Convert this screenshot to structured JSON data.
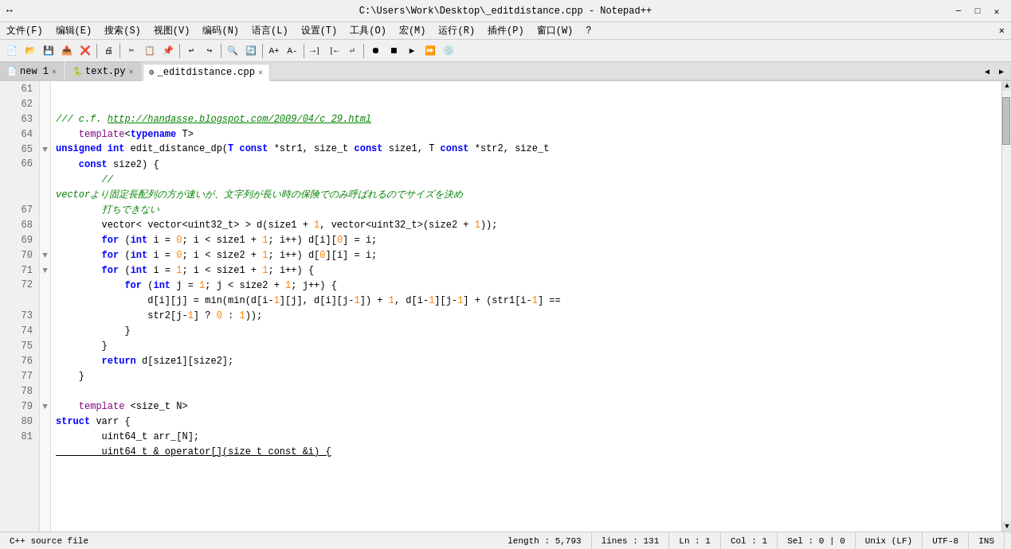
{
  "titlebar": {
    "title": "C:\\Users\\Work\\Desktop\\_editdistance.cpp - Notepad++",
    "minimize": "─",
    "maximize": "□",
    "close": "✕",
    "arrows": "↔"
  },
  "menubar": {
    "items": [
      "文件(F)",
      "编辑(E)",
      "搜索(S)",
      "视图(V)",
      "编码(N)",
      "语言(L)",
      "设置(T)",
      "工具(O)",
      "宏(M)",
      "运行(R)",
      "插件(P)",
      "窗口(W)",
      "?"
    ]
  },
  "tabs": [
    {
      "id": "new1",
      "label": "new 1",
      "icon": "📄",
      "active": false
    },
    {
      "id": "text_py",
      "label": "text.py",
      "icon": "🐍",
      "active": false
    },
    {
      "id": "editdistance",
      "label": "_editdistance.cpp",
      "icon": "⚙",
      "active": true
    }
  ],
  "statusbar": {
    "file_type": "C++ source file",
    "length": "length : 5,793",
    "lines": "lines : 131",
    "ln": "Ln : 1",
    "col": "Col : 1",
    "sel": "Sel : 0 | 0",
    "eol": "Unix (LF)",
    "encoding": "UTF-8",
    "ins": "INS"
  },
  "code": {
    "lines": [
      {
        "num": "61",
        "fold": "",
        "content": ""
      },
      {
        "num": "62",
        "fold": "",
        "content": ""
      },
      {
        "num": "63",
        "fold": "",
        "content": "    <comment>/// c.f. <url>http://handasse.blogspot.com/2009/04/c_29.html</url></comment>"
      },
      {
        "num": "64",
        "fold": "",
        "content": "    <template>template</template><plain>&lt;</plain><keyword>typename</keyword><plain> T&gt;</plain>"
      },
      {
        "num": "65",
        "fold": "▼",
        "content": "<keyword>unsigned</keyword><plain> </plain><keyword>int</keyword><plain> edit_distance_dp(</plain><keyword>T</keyword><plain> </plain><keyword>const</keyword><plain> *str1, size_t </plain><keyword>const</keyword><plain> size1, T </plain><keyword>const</keyword><plain> *str2, size_t</plain>"
      },
      {
        "num": "66",
        "fold": "",
        "content": "    <keyword>const</keyword><plain> size2) {</plain>\n        <comment>//</comment>\n        <comment>vectorより固定長配列の方が速いが、文字列が長い時の保険でのみ呼ばれるのでサイズを決め</comment>\n        <comment>打ちできない</comment>"
      },
      {
        "num": "67",
        "fold": "",
        "content": "        vector&lt; vector&lt;uint32_t&gt; &gt; d(size1 + <number>1</number>, vector&lt;uint32_t&gt;(size2 + <number>1</number>));"
      },
      {
        "num": "68",
        "fold": "",
        "content": "        <keyword>for</keyword> (<keyword>int</keyword> i = <number>0</number>; i &lt; size1 + <number>1</number>; i++) d[i][<number>0</number>] = i;"
      },
      {
        "num": "69",
        "fold": "",
        "content": "        <keyword>for</keyword> (<keyword>int</keyword> i = <number>0</number>; i &lt; size2 + <number>1</number>; i++) d[<number>0</number>][i] = i;"
      },
      {
        "num": "70",
        "fold": "▼",
        "content": "        <keyword>for</keyword> (<keyword>int</keyword> i = <number>1</number>; i &lt; size1 + <number>1</number>; i++) {"
      },
      {
        "num": "71",
        "fold": "▼",
        "content": "            <keyword>for</keyword> (<keyword>int</keyword> j = <number>1</number>; j &lt; size2 + <number>1</number>; j++) {"
      },
      {
        "num": "72",
        "fold": "",
        "content": "                d[i][j] = min(min(d[i-<number>1</number>][j], d[i][j-<number>1</number>]) + <number>1</number>, d[i-<number>1</number>][j-<number>1</number>] + (str1[i-<number>1</number>] ==\n                str2[j-<number>1</number>] ? <number>0</number> : <number>1</number>));"
      },
      {
        "num": "73",
        "fold": "",
        "content": "            }"
      },
      {
        "num": "74",
        "fold": "",
        "content": "        }"
      },
      {
        "num": "75",
        "fold": "",
        "content": "        <keyword>return</keyword> d[size1][size2];"
      },
      {
        "num": "76",
        "fold": "",
        "content": "    }"
      },
      {
        "num": "77",
        "fold": "",
        "content": ""
      },
      {
        "num": "78",
        "fold": "",
        "content": "    <template>template</template><plain> &lt;size_t N&gt;</plain>"
      },
      {
        "num": "79",
        "fold": "▼",
        "content": "<keyword>struct</keyword> varr {"
      },
      {
        "num": "80",
        "fold": "",
        "content": "        uint64_t arr_[N];"
      },
      {
        "num": "81",
        "fold": "",
        "content": "        <underline>uint64_t &amp; operator[](size_t const &amp;i) {</underline>"
      }
    ]
  }
}
